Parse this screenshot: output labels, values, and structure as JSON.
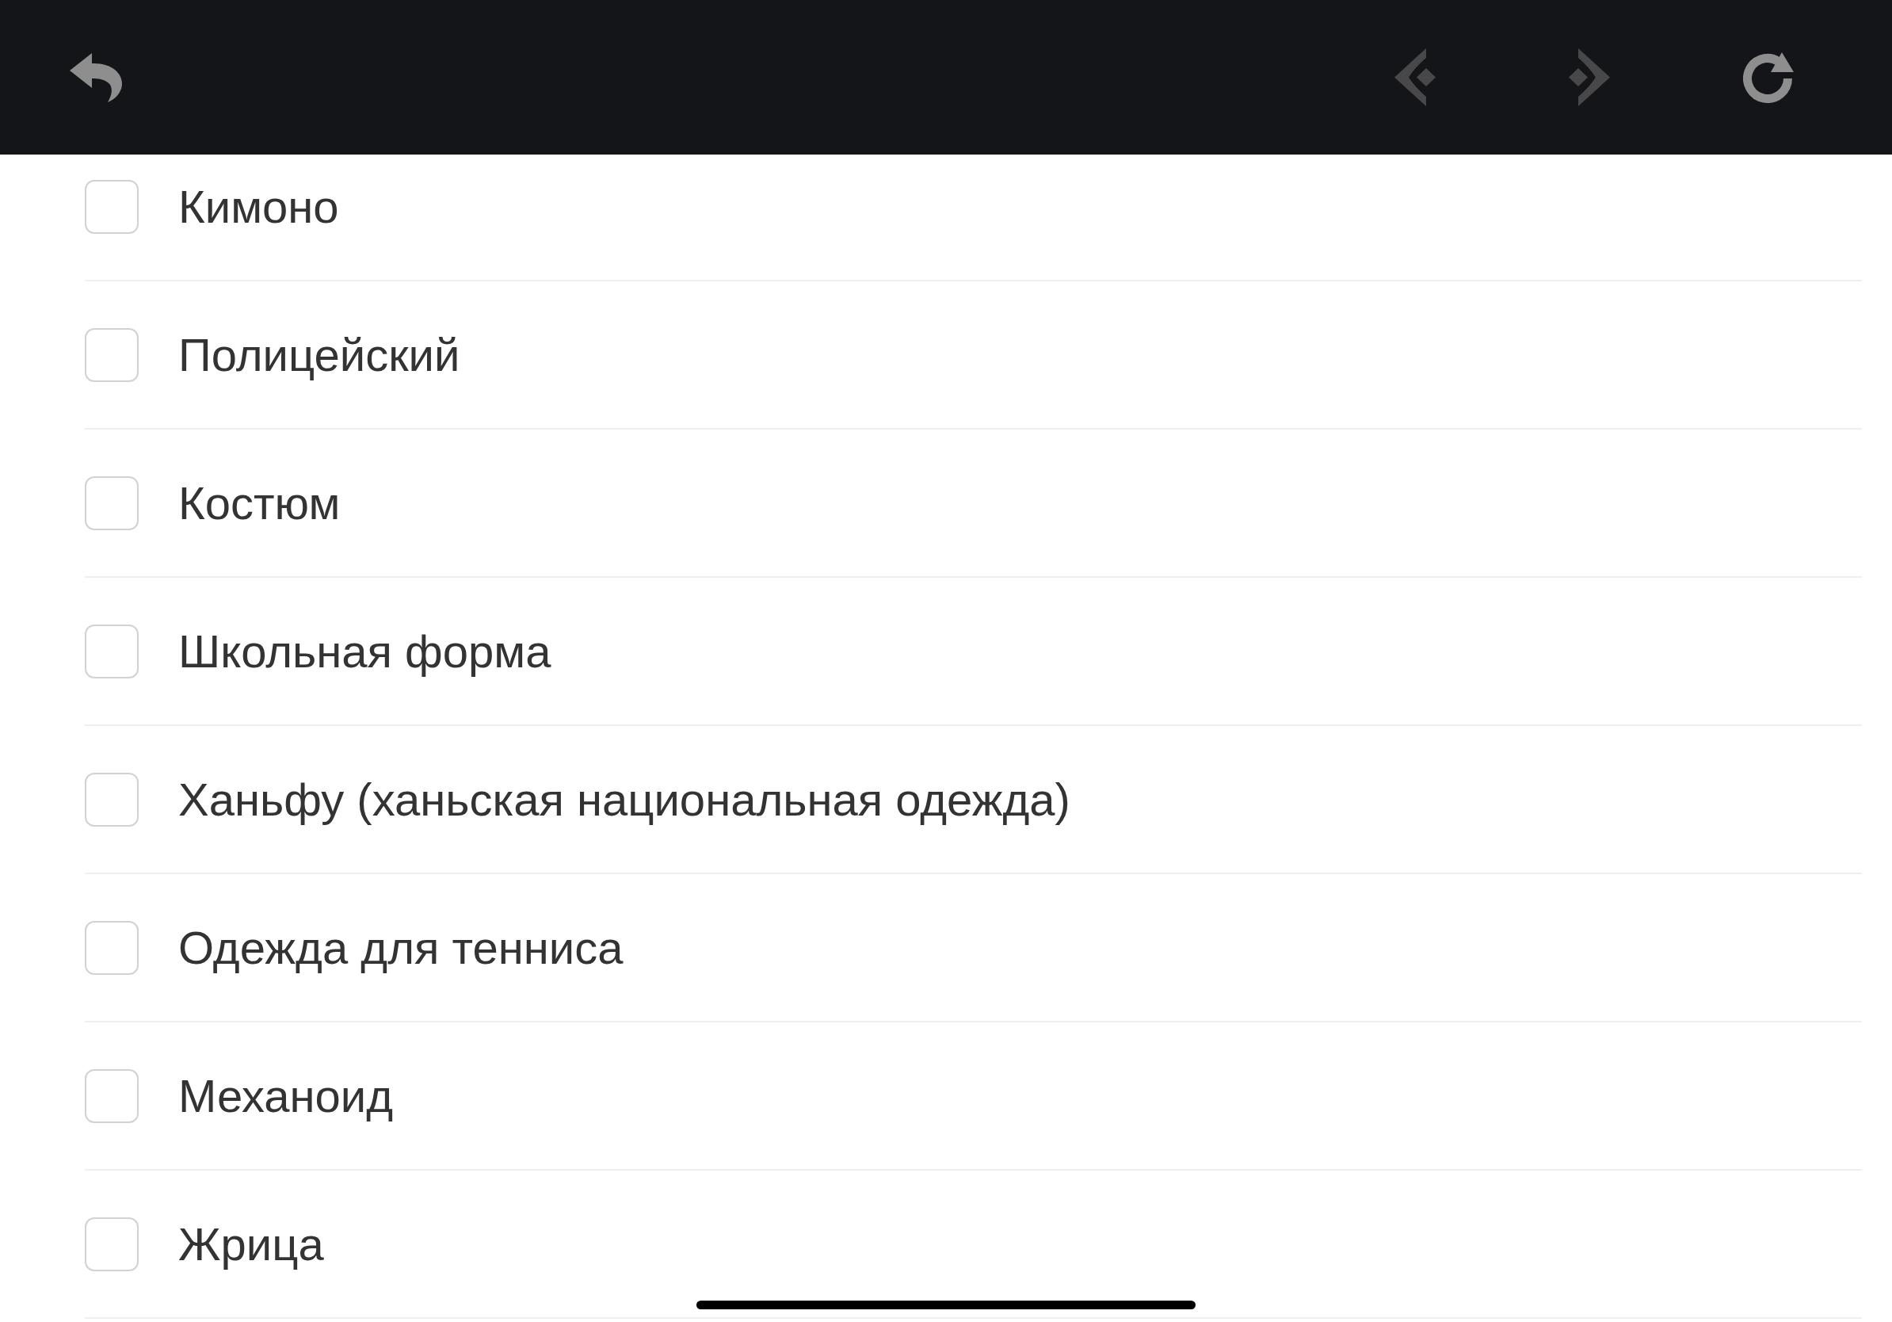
{
  "toolbar": {
    "buttons": [
      {
        "kind": "back",
        "disabled": false
      },
      {
        "kind": "previous",
        "disabled": true
      },
      {
        "kind": "next",
        "disabled": true
      },
      {
        "kind": "reload",
        "disabled": false
      }
    ]
  },
  "options": [
    {
      "label": "Кимоно",
      "checked": false
    },
    {
      "label": "Полицейский",
      "checked": false
    },
    {
      "label": "Костюм",
      "checked": false
    },
    {
      "label": "Школьная форма",
      "checked": false
    },
    {
      "label": "Ханьфу (ханьская национальная одежда)",
      "checked": false
    },
    {
      "label": "Одежда для тенниса",
      "checked": false
    },
    {
      "label": "Механоид",
      "checked": false
    },
    {
      "label": "Жрица",
      "checked": false
    }
  ]
}
